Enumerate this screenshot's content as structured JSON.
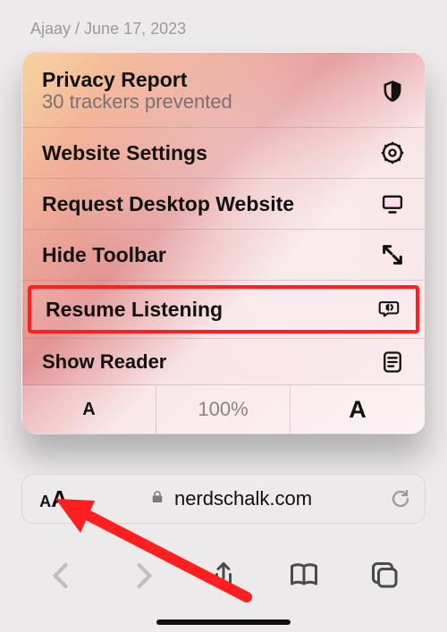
{
  "byline": {
    "author": "Ajaay",
    "sep": " / ",
    "date": "June 17, 2023"
  },
  "popover": {
    "privacy": {
      "title": "Privacy Report",
      "subtitle": "30 trackers prevented"
    },
    "website_settings": "Website Settings",
    "request_desktop": "Request Desktop Website",
    "hide_toolbar": "Hide Toolbar",
    "resume_listening": "Resume Listening",
    "show_reader": "Show Reader",
    "zoom": {
      "percent": "100%",
      "decrease_glyph": "A",
      "increase_glyph": "A"
    }
  },
  "addressbar": {
    "domain": "nerdschalk.com"
  },
  "highlight_color": "#ff1f1f"
}
